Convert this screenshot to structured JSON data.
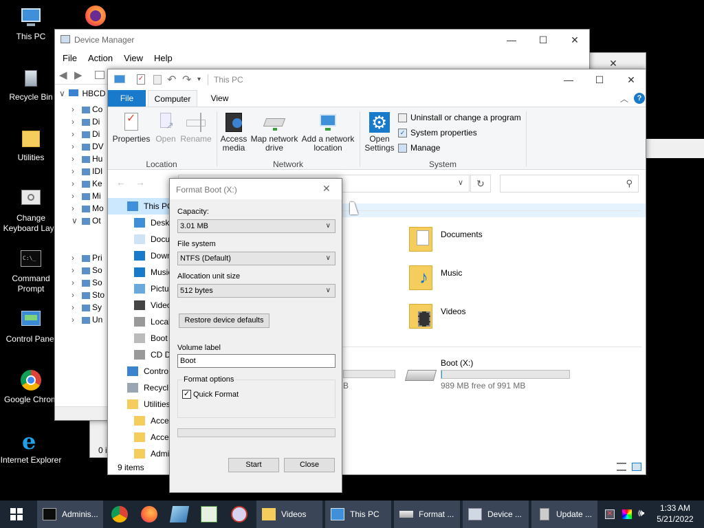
{
  "desktop": {
    "icons": [
      {
        "label": "This PC",
        "icon": "this-pc-icon"
      },
      {
        "label": "Recycle Bin",
        "icon": "recycle-bin-icon"
      },
      {
        "label": "Utilities",
        "icon": "folder-icon"
      },
      {
        "label": "Change Keyboard Layo",
        "icon": "keyboard-settings-icon"
      },
      {
        "label": "Command Prompt",
        "icon": "command-prompt-icon"
      },
      {
        "label": "Control Panel",
        "icon": "control-panel-icon"
      },
      {
        "label": "Google Chrom",
        "icon": "chrome-icon"
      },
      {
        "label": "Internet Explorer",
        "icon": "internet-explorer-icon"
      }
    ]
  },
  "device_manager": {
    "title": "Device Manager",
    "menu": [
      "File",
      "Action",
      "View",
      "Help"
    ],
    "root": "HBCD",
    "tree_items": [
      "Co",
      "Di",
      "Di",
      "DV",
      "Hu",
      "IDI",
      "Ke",
      "Mi",
      "Mo",
      "Ot",
      "",
      "",
      "Pri",
      "So",
      "So",
      "Sto",
      "Sy",
      "Un"
    ],
    "status_prefix": "0 i"
  },
  "explorer": {
    "title": "This PC",
    "tabs": {
      "file": "File",
      "computer": "Computer",
      "view": "View"
    },
    "ribbon": {
      "properties": "Properties",
      "open": "Open",
      "rename": "Rename",
      "access_media": "Access media",
      "map_network_drive": "Map network drive",
      "add_network_location_1": "Add a network",
      "add_network_location_2": "location",
      "open_settings_1": "Open",
      "open_settings_2": "Settings",
      "uninstall": "Uninstall or change a program",
      "system_properties": "System properties",
      "manage": "Manage",
      "group_location": "Location",
      "group_network": "Network",
      "group_system": "System"
    },
    "nav_items": [
      "This PC",
      "Deskt",
      "Docu",
      "Down",
      "Music",
      "Pictur",
      "Video",
      "Local",
      "Boot",
      "CD D",
      "Contro",
      "Recycl",
      "Utilities",
      "Acces",
      "Acces",
      "Admi"
    ],
    "folders": [
      "Documents",
      "Music",
      "Videos"
    ],
    "drive": {
      "name": "Boot (X:)",
      "free": "989 MB free of 991 MB",
      "used_fraction": 0.002
    },
    "partial_drive_text": "B",
    "status": "9 items"
  },
  "format_dialog": {
    "title": "Format Boot (X:)",
    "capacity_label": "Capacity:",
    "capacity_value": "3.01 MB",
    "filesystem_label": "File system",
    "filesystem_value": "NTFS (Default)",
    "allocation_label": "Allocation unit size",
    "allocation_value": "512 bytes",
    "restore_button": "Restore device defaults",
    "volume_label": "Volume label",
    "volume_value": "Boot",
    "format_options_label": "Format options",
    "quick_format_label": "Quick Format",
    "quick_format_checked": true,
    "progress": 0,
    "start_button": "Start",
    "close_button": "Close"
  },
  "taskbar": {
    "tasks": [
      {
        "label": "Adminis...",
        "icon": "command-prompt-icon"
      },
      {
        "label": "Videos",
        "icon": "videos-folder-icon"
      },
      {
        "label": "This PC",
        "icon": "this-pc-icon"
      },
      {
        "label": "Format ...",
        "icon": "drive-icon"
      },
      {
        "label": "Device ...",
        "icon": "device-manager-icon"
      },
      {
        "label": "Update ...",
        "icon": "update-icon"
      }
    ],
    "time": "1:33 AM",
    "date": "5/21/2022"
  },
  "colors": {
    "accent": "#1979ca",
    "taskbar": "#1c2633",
    "file_tab": "#1979ca"
  }
}
